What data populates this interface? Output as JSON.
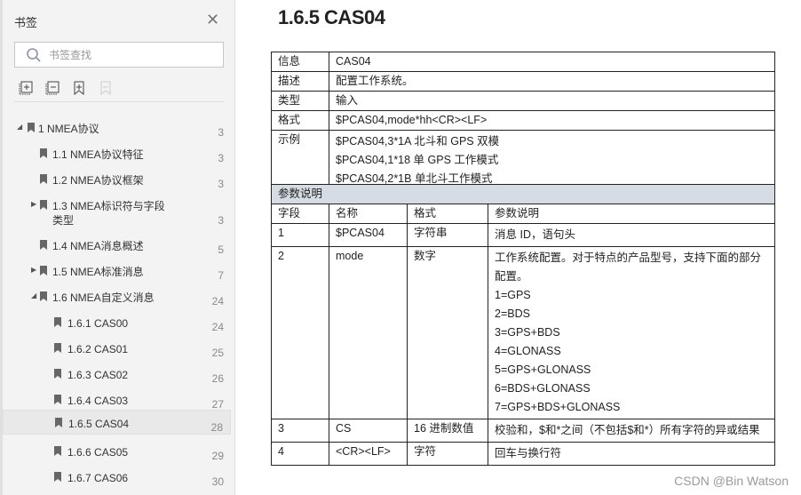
{
  "sidebar": {
    "title": "书签",
    "search_placeholder": "书签查找",
    "tools": [
      "expand-all-icon",
      "collapse-all-icon",
      "add-bookmark-icon",
      "remove-bookmark-icon"
    ],
    "items": [
      {
        "label": "1 NMEA协议",
        "page": "3",
        "level": 0,
        "toggle": "▲"
      },
      {
        "label": "1.1 NMEA协议特征",
        "page": "3",
        "level": 1
      },
      {
        "label": "1.2 NMEA协议框架",
        "page": "3",
        "level": 1
      },
      {
        "label": "1.3 NMEA标识符与字段",
        "label2": "类型",
        "page": "3",
        "level": 1,
        "toggle": "▶"
      },
      {
        "label": "1.4 NMEA消息概述",
        "page": "5",
        "level": 1
      },
      {
        "label": "1.5 NMEA标准消息",
        "page": "7",
        "level": 1,
        "toggle": "▶"
      },
      {
        "label": "1.6 NMEA自定义消息",
        "page": "24",
        "level": 1,
        "toggle": "▲"
      },
      {
        "label": "1.6.1 CAS00",
        "page": "24",
        "level": 2
      },
      {
        "label": "1.6.2 CAS01",
        "page": "25",
        "level": 2
      },
      {
        "label": "1.6.3 CAS02",
        "page": "26",
        "level": 2
      },
      {
        "label": "1.6.4 CAS03",
        "page": "27",
        "level": 2
      },
      {
        "label": "1.6.5 CAS04",
        "page": "28",
        "level": 2,
        "selected": true
      },
      {
        "label": "1.6.6 CAS05",
        "page": "29",
        "level": 2
      },
      {
        "label": "1.6.7 CAS06",
        "page": "30",
        "level": 2
      }
    ]
  },
  "doc": {
    "heading": "1.6.5 CAS04",
    "info": [
      {
        "k": "信息",
        "v": [
          "CAS04"
        ]
      },
      {
        "k": "描述",
        "v": [
          "配置工作系统。"
        ]
      },
      {
        "k": "类型",
        "v": [
          "输入"
        ]
      },
      {
        "k": "格式",
        "v": [
          "$PCAS04,mode*hh<CR><LF>"
        ]
      },
      {
        "k": "示例",
        "v": [
          "$PCAS04,3*1A 北斗和 GPS 双模",
          "$PCAS04,1*18 单 GPS 工作模式",
          "$PCAS04,2*1B 单北斗工作模式"
        ]
      }
    ],
    "param_section": "参数说明",
    "param_headers": [
      "字段",
      "名称",
      "格式",
      "参数说明"
    ],
    "params": [
      {
        "f": "1",
        "n": "$PCAS04",
        "t": "字符串",
        "d": [
          "消息 ID，语句头"
        ]
      },
      {
        "f": "2",
        "n": "mode",
        "t": "数字",
        "d": [
          "工作系统配置。对于特点的产品型号，支持下面的部分配置。",
          "1=GPS",
          "2=BDS",
          "3=GPS+BDS",
          "4=GLONASS",
          "5=GPS+GLONASS",
          "6=BDS+GLONASS",
          "7=GPS+BDS+GLONASS"
        ]
      },
      {
        "f": "3",
        "n": "CS",
        "t": "16 进制数值",
        "d": [
          "校验和，$和*之间（不包括$和*）所有字符的异或结果"
        ]
      },
      {
        "f": "4",
        "n": "<CR><LF>",
        "t": "字符",
        "d": [
          "回车与换行符"
        ]
      }
    ]
  },
  "watermark": "CSDN @Bin Watson"
}
